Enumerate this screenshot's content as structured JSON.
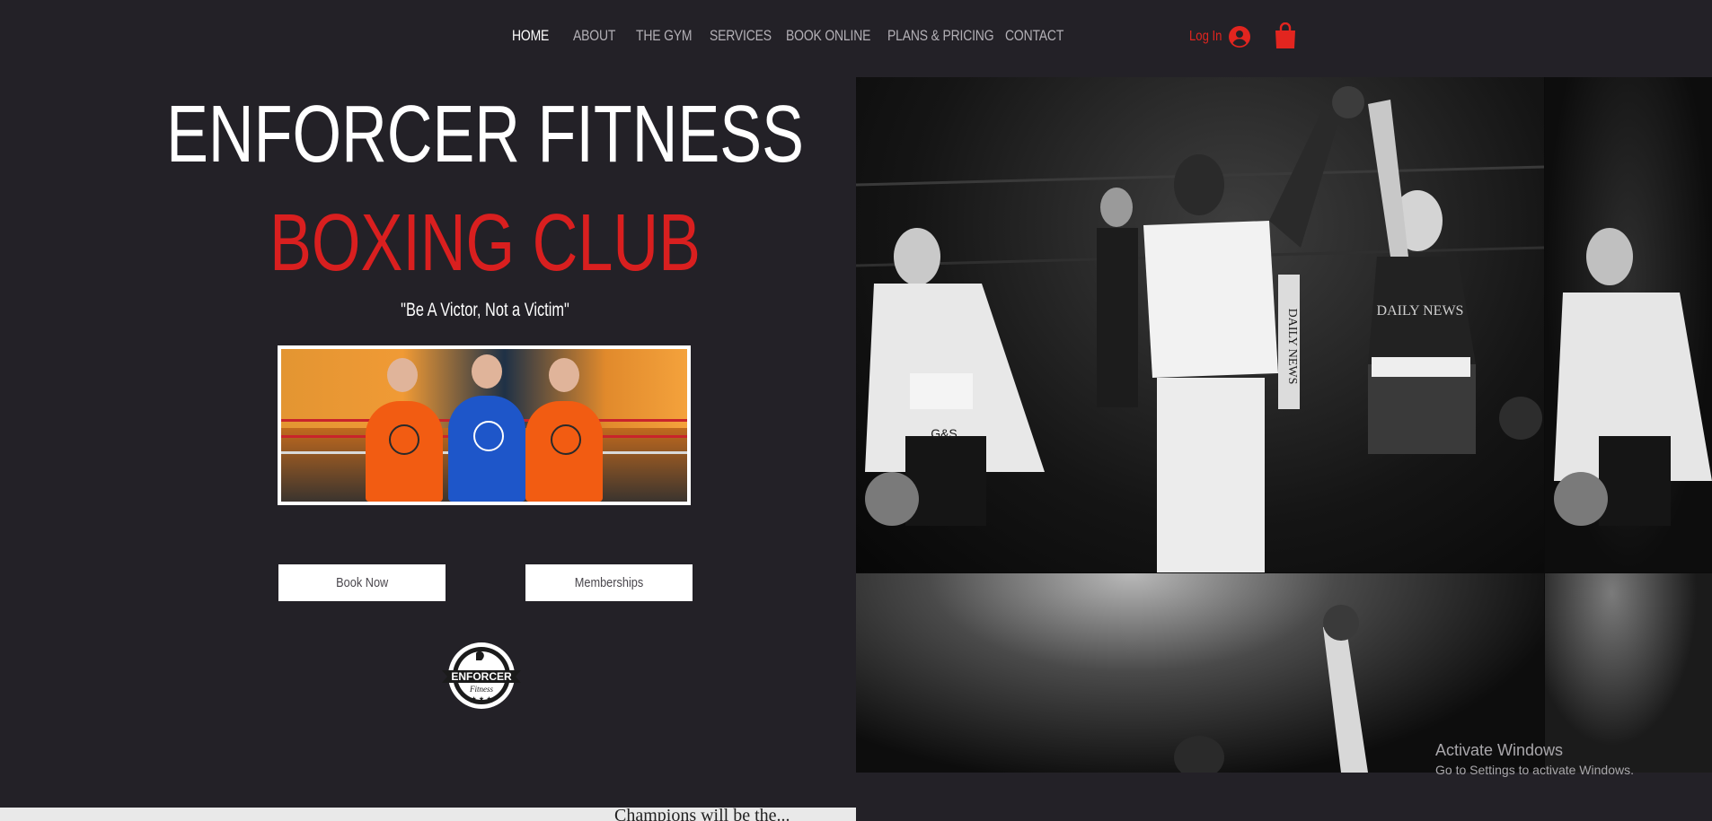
{
  "header": {
    "nav": [
      {
        "label": "HOME",
        "active": true
      },
      {
        "label": "ABOUT",
        "active": false
      },
      {
        "label": "THE GYM",
        "active": false
      },
      {
        "label": "SERVICES",
        "active": false
      },
      {
        "label": "BOOK ONLINE",
        "active": false
      },
      {
        "label": "PLANS & PRICING",
        "active": false
      },
      {
        "label": "CONTACT",
        "active": false
      }
    ],
    "login_label": "Log In",
    "icons": {
      "account": "account-icon",
      "cart": "shopping-bag-icon"
    }
  },
  "hero": {
    "title": "ENFORCER FITNESS",
    "subtitle": "BOXING CLUB",
    "quote": "\"Be A Victor, Not a Victim\"",
    "book_button": "Book Now",
    "memberships_button": "Memberships",
    "badge_text": "ENFORCER",
    "badge_script": "Fitness"
  },
  "collage": {
    "main_trunks_text": "DAILY NEWS",
    "banner_text": "DAILY NEWS",
    "shorts_text": "G&S"
  },
  "news_strip": {
    "text": "Champions will be the..."
  },
  "watermark": {
    "title": "Activate Windows",
    "subtitle": "Go to Settings to activate Windows."
  },
  "colors": {
    "background": "#232127",
    "accent_red": "#d91f1f",
    "login_red": "#e2251f",
    "nav_text": "#b3b0b6"
  }
}
